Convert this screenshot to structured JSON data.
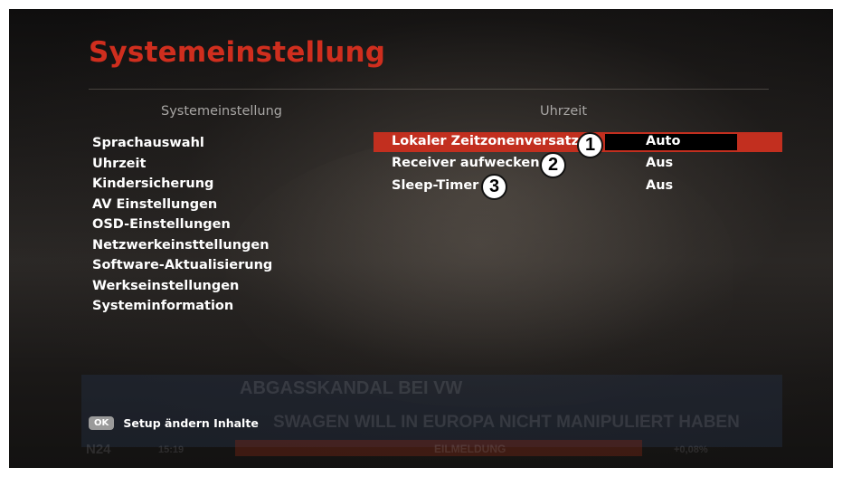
{
  "header": {
    "title": "Systemeinstellung"
  },
  "left_panel": {
    "heading": "Systemeinstellung",
    "items": [
      {
        "label": "Sprachauswahl"
      },
      {
        "label": "Uhrzeit"
      },
      {
        "label": "Kindersicherung"
      },
      {
        "label": "AV Einstellungen"
      },
      {
        "label": "OSD-Einstellungen"
      },
      {
        "label": "Netzwerkeinsttellungen"
      },
      {
        "label": "Software-Aktualisierung"
      },
      {
        "label": "Werkseinstellungen"
      },
      {
        "label": "Systeminformation"
      }
    ]
  },
  "right_panel": {
    "heading": "Uhrzeit",
    "settings": [
      {
        "label": "Lokaler Zeitzonenversatz",
        "value": "Auto",
        "selected": true,
        "callout": "1"
      },
      {
        "label": "Receiver aufwecken",
        "value": "Aus",
        "selected": false,
        "callout": "2"
      },
      {
        "label": "Sleep-Timer",
        "value": "Aus",
        "selected": false,
        "callout": "3"
      }
    ]
  },
  "footer": {
    "key_label": "OK",
    "hint": "Setup ändern Inhalte"
  },
  "background_tv": {
    "headline": "ABGASSKANDAL BEI VW",
    "subline": "SWAGEN WILL IN EUROPA NICHT MANIPULIERT HABEN",
    "channel": "N24",
    "time": "15:19",
    "ticker": "EILMELDUNG",
    "percent": "+0,08%"
  },
  "colors": {
    "accent_red": "#cf2e1e",
    "selection_bar": "#c22f1f",
    "text": "#ffffff",
    "heading_gray": "#a8a6a4"
  }
}
